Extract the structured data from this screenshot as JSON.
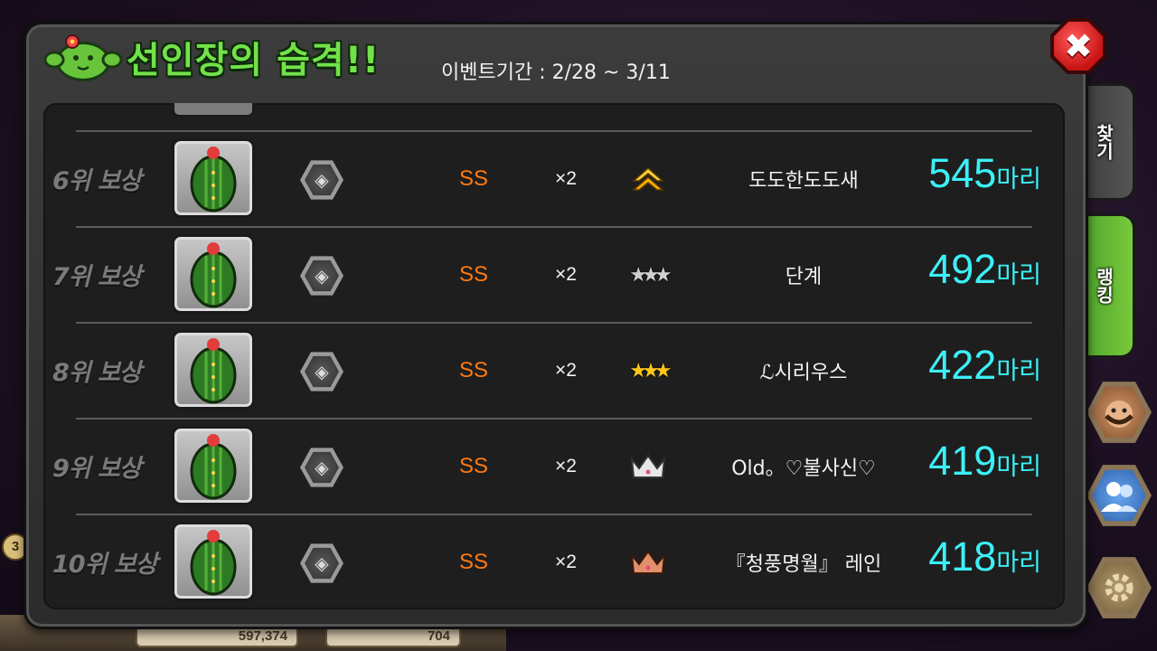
{
  "header": {
    "title": "선인장의 습격!!",
    "period": "이벤트기간 : 2/28 ~ 3/11"
  },
  "tabs": [
    {
      "label": "찾기"
    },
    {
      "label": "랭킹"
    }
  ],
  "rewards": [
    {
      "rank": "6위 보상",
      "grade": "SS",
      "qty": "×2",
      "tier_icon": "gold-chevron-icon",
      "player": "도도한도도새",
      "score": "545",
      "unit": "마리"
    },
    {
      "rank": "7위 보상",
      "grade": "SS",
      "qty": "×2",
      "tier_icon": "silver-stars-icon",
      "player": "단계",
      "score": "492",
      "unit": "마리"
    },
    {
      "rank": "8위 보상",
      "grade": "SS",
      "qty": "×2",
      "tier_icon": "gold-stars-icon",
      "player": "ℒ시리우스",
      "score": "422",
      "unit": "마리"
    },
    {
      "rank": "9위 보상",
      "grade": "SS",
      "qty": "×2",
      "tier_icon": "silver-crown-icon",
      "player": "Old。♡불사신♡",
      "score": "419",
      "unit": "마리"
    },
    {
      "rank": "10위 보상",
      "grade": "SS",
      "qty": "×2",
      "tier_icon": "bronze-crown-icon",
      "player": "『청풍명월』 레인",
      "score": "418",
      "unit": "마리"
    }
  ],
  "background": {
    "level": "3",
    "gold": "597,374",
    "gems": "704"
  },
  "colors": {
    "title": "#72e24a",
    "score": "#3cf0f6",
    "grade": "#ff7a14",
    "rank": "#7a7a7a"
  }
}
